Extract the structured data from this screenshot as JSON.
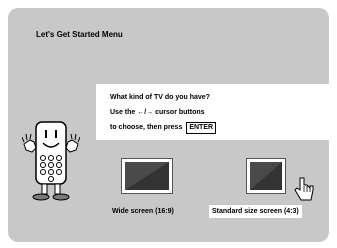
{
  "menu": {
    "title": "Let's Get Started Menu"
  },
  "question": {
    "line1": "What kind of TV do you have?",
    "line2_prefix": "Use the ",
    "arrows": "←/→",
    "line2_suffix": " cursor buttons",
    "line3_prefix": "to choose, then press",
    "enter_key": "ENTER"
  },
  "options": [
    {
      "label": "Wide screen (16:9)",
      "selected": false
    },
    {
      "label": "Standard size screen (4:3)",
      "selected": true
    }
  ],
  "icons": {
    "mascot": "remote-control-mascot-icon",
    "pointer": "pointing-hand-icon",
    "tv": "tv-screen-icon"
  },
  "colors": {
    "background": "#c8c8c8",
    "panel": "#ffffff",
    "tv_screen": "#4a4a4a"
  }
}
